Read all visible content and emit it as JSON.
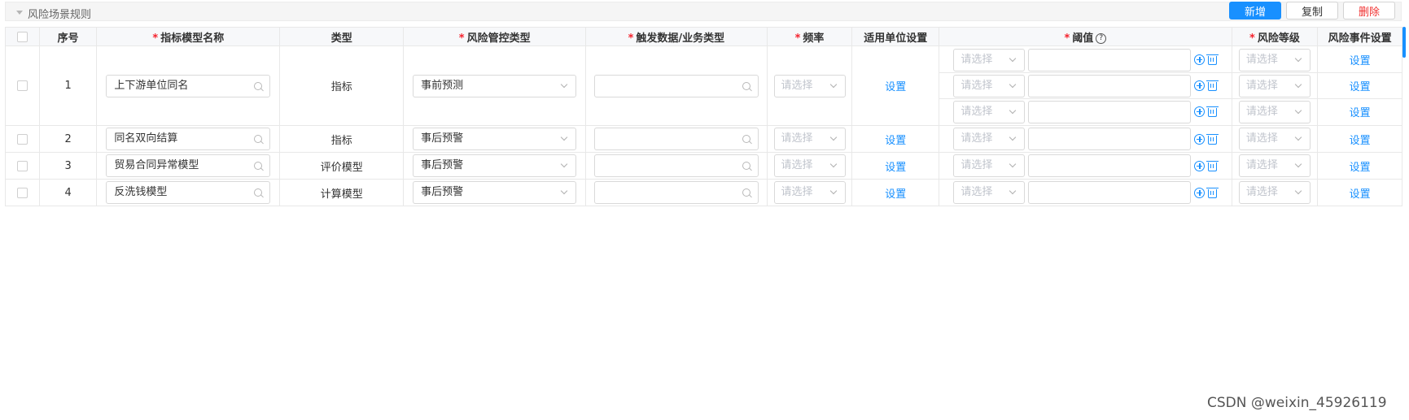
{
  "panel": {
    "title": "风险场景规则"
  },
  "toolbar": {
    "add_label": "新增",
    "copy_label": "复制",
    "delete_label": "删除"
  },
  "columns": {
    "seq": "序号",
    "model_name": "指标模型名称",
    "type": "类型",
    "control_type": "风险管控类型",
    "trigger": "触发数据/业务类型",
    "frequency": "频率",
    "unit_setting": "适用单位设置",
    "threshold": "阈值",
    "risk_level": "风险等级",
    "event_setting": "风险事件设置"
  },
  "required_mark": "*",
  "help_icon_glyph": "?",
  "select_placeholder": "请选择",
  "link_label": "设置",
  "rows": [
    {
      "seq": "1",
      "name": "上下游单位同名",
      "type": "指标",
      "control": "事前预测"
    },
    {
      "seq": "2",
      "name": "同名双向结算",
      "type": "指标",
      "control": "事后预警"
    },
    {
      "seq": "3",
      "name": "贸易合同异常模型",
      "type": "评价模型",
      "control": "事后预警"
    },
    {
      "seq": "4",
      "name": "反洗钱模型",
      "type": "计算模型",
      "control": "事后预警"
    }
  ],
  "colors": {
    "primary": "#1890ff",
    "danger": "#f0302f",
    "required": "#f5222d"
  },
  "watermark": "CSDN @weixin_45926119"
}
